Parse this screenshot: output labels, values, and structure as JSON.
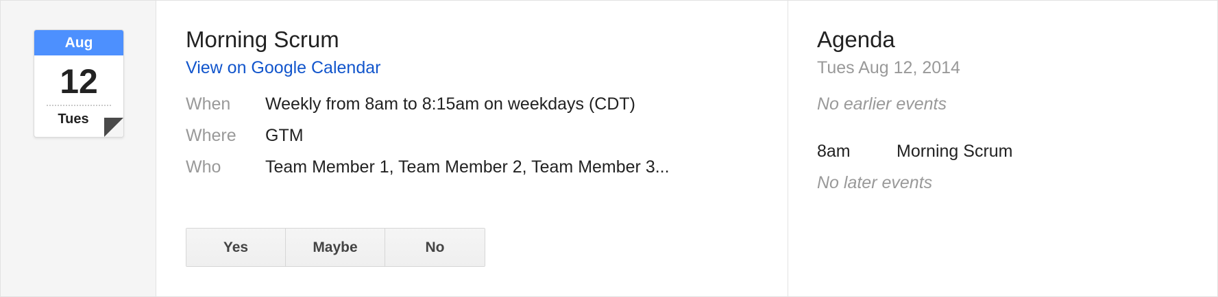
{
  "calendar_icon": {
    "month": "Aug",
    "day": "12",
    "weekday": "Tues",
    "month_color": "#4d90fe"
  },
  "event": {
    "title": "Morning Scrum",
    "link_label": "View on Google Calendar",
    "details": [
      {
        "label": "When",
        "value": "Weekly from 8am to 8:15am on weekdays (CDT)"
      },
      {
        "label": "Where",
        "value": "GTM"
      },
      {
        "label": "Who",
        "value": "Team Member 1, Team Member 2, Team Member 3..."
      }
    ]
  },
  "rsvp": {
    "yes_label": "Yes",
    "maybe_label": "Maybe",
    "no_label": "No"
  },
  "agenda": {
    "title": "Agenda",
    "date": "Tues Aug 12, 2014",
    "earlier_note": "No earlier events",
    "events": [
      {
        "time": "8am",
        "title": "Morning Scrum"
      }
    ],
    "later_note": "No later events"
  },
  "colors": {
    "link": "#1155cc",
    "muted": "#999999",
    "accent": "#4d90fe"
  }
}
